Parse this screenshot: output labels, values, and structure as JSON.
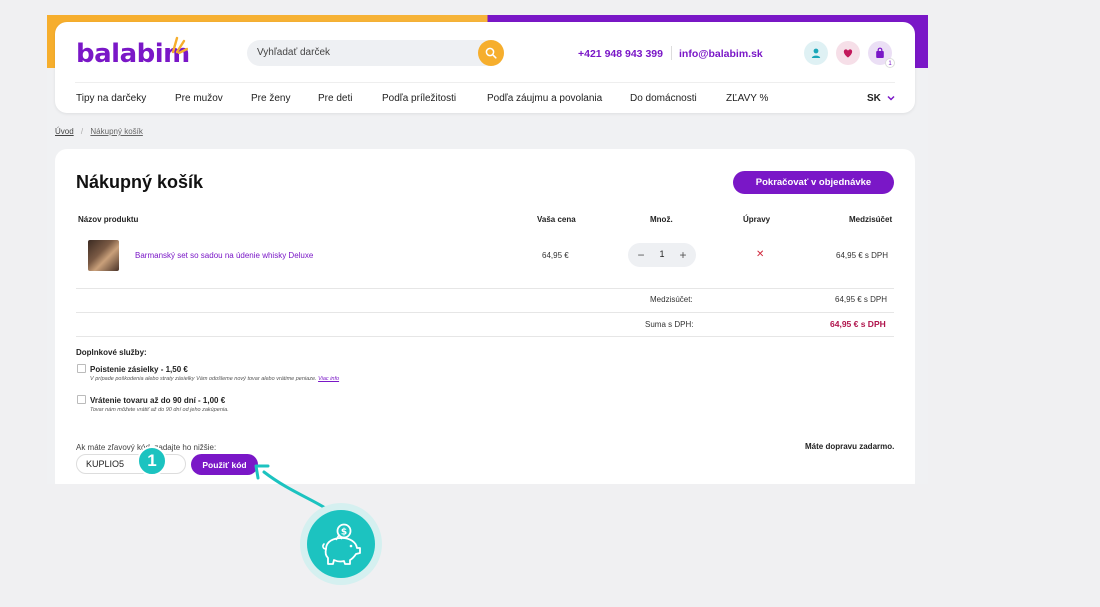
{
  "header": {
    "logo_text": "balabim",
    "search_placeholder": "Vyhľadať darček",
    "phone": "+421 948 943 399",
    "email": "info@balabim.sk",
    "cart_count": "1",
    "language": "SK"
  },
  "nav": {
    "items": [
      "Tipy na darčeky",
      "Pre mužov",
      "Pre ženy",
      "Pre deti",
      "Podľa príležitosti",
      "Podľa záujmu a povolania",
      "Do domácnosti",
      "ZĽAVY %"
    ]
  },
  "breadcrumb": {
    "home": "Úvod",
    "current": "Nákupný košík"
  },
  "cart": {
    "title": "Nákupný košík",
    "continue_label": "Pokračovať v objednávke",
    "columns": {
      "product": "Názov produktu",
      "price": "Vaša cena",
      "qty": "Množ.",
      "edit": "Úpravy",
      "subtotal": "Medzisúčet"
    },
    "items": [
      {
        "name": "Barmanský set so sadou na údenie whisky Deluxe",
        "price": "64,95 €",
        "qty": "1",
        "subtotal": "64,95 € s DPH"
      }
    ],
    "summary": {
      "subtotal_label": "Medzisúčet:",
      "subtotal_value": "64,95 € s DPH",
      "total_label": "Suma s DPH:",
      "total_value": "64,95 € s DPH"
    }
  },
  "addons": {
    "title": "Doplnkové služby:",
    "options": [
      {
        "title": "Poistenie zásielky - 1,50 €",
        "desc": "V prípade poškodenia alebo straty zásielky Vám odošleme nový tovar alebo vrátime peniaze.",
        "more": "Viac info"
      },
      {
        "title": "Vrátenie tovaru až do 90 dní - 1,00 €",
        "desc": "Tovar nám môžete vrátiť až do 90 dní od jeho zakúpenia.",
        "more": ""
      }
    ]
  },
  "discount": {
    "label": "Ak máte zľavový kód, zadajte ho nižšie:",
    "code_value": "KUPLIO5",
    "apply_label": "Použiť kód",
    "free_shipping": "Máte dopravu zadarmo."
  },
  "annotation": {
    "step_number": "1"
  },
  "colors": {
    "brand_purple": "#7a17c7",
    "brand_orange": "#f6ae2d",
    "accent_teal": "#1cc3c0",
    "total_red": "#b0144c"
  }
}
